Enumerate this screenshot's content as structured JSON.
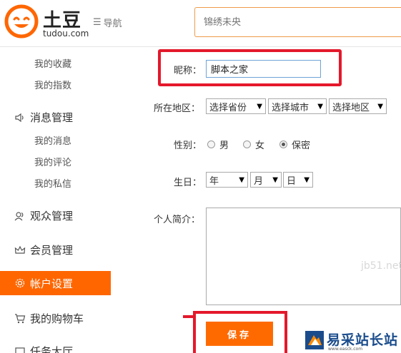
{
  "header": {
    "logo_cn": "土豆",
    "logo_en": "tudou.com",
    "nav_label": "导航",
    "search_placeholder": "锦绣未央"
  },
  "sidebar": {
    "sub_top": [
      "我的收藏",
      "我的指数"
    ],
    "message_group": "消息管理",
    "message_items": [
      "我的消息",
      "我的评论",
      "我的私信"
    ],
    "audience": "观众管理",
    "member": "会员管理",
    "account_settings": "帐户设置",
    "cart": "我的购物车",
    "task": "任务大厅"
  },
  "form": {
    "nickname_label": "昵称：",
    "nickname_value": "脚本之家",
    "region_label": "所在地区：",
    "province": "选择省份",
    "city": "选择城市",
    "district": "选择地区",
    "gender_label": "性别：",
    "gender_options": [
      "男",
      "女",
      "保密"
    ],
    "gender_selected": "保密",
    "birthday_label": "生日：",
    "year": "年",
    "month": "月",
    "day": "日",
    "bio_label": "个人简介：",
    "save_label": "保存"
  },
  "watermark": {
    "partial_url": "jb51.net",
    "site_name": "易采站长站",
    "site_url": "www.easck.com"
  },
  "colors": {
    "accent": "#ff6600",
    "highlight_box": "#e4182b"
  }
}
